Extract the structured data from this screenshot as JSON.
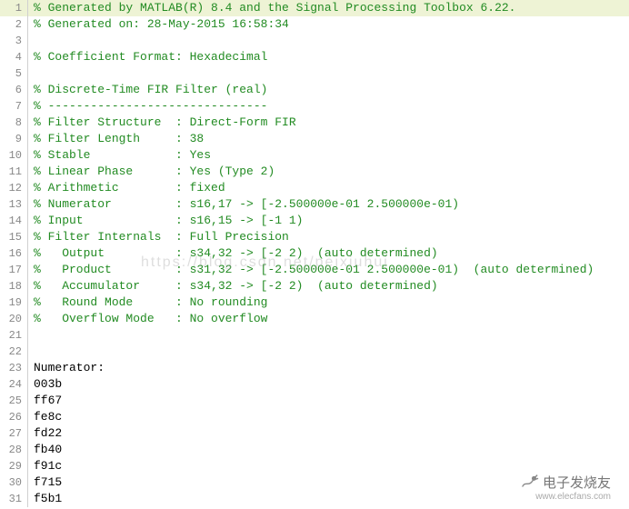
{
  "lines": [
    {
      "num": 1,
      "text": "% Generated by MATLAB(R) 8.4 and the Signal Processing Toolbox 6.22.",
      "comment": true,
      "hl": true
    },
    {
      "num": 2,
      "text": "% Generated on: 28-May-2015 16:58:34",
      "comment": true
    },
    {
      "num": 3,
      "text": "",
      "comment": true
    },
    {
      "num": 4,
      "text": "% Coefficient Format: Hexadecimal",
      "comment": true
    },
    {
      "num": 5,
      "text": "",
      "comment": true
    },
    {
      "num": 6,
      "text": "% Discrete-Time FIR Filter (real)",
      "comment": true
    },
    {
      "num": 7,
      "text": "% -------------------------------",
      "comment": true
    },
    {
      "num": 8,
      "text": "% Filter Structure  : Direct-Form FIR",
      "comment": true
    },
    {
      "num": 9,
      "text": "% Filter Length     : 38",
      "comment": true
    },
    {
      "num": 10,
      "text": "% Stable            : Yes",
      "comment": true
    },
    {
      "num": 11,
      "text": "% Linear Phase      : Yes (Type 2)",
      "comment": true
    },
    {
      "num": 12,
      "text": "% Arithmetic        : fixed",
      "comment": true
    },
    {
      "num": 13,
      "text": "% Numerator         : s16,17 -> [-2.500000e-01 2.500000e-01)",
      "comment": true
    },
    {
      "num": 14,
      "text": "% Input             : s16,15 -> [-1 1)",
      "comment": true
    },
    {
      "num": 15,
      "text": "% Filter Internals  : Full Precision",
      "comment": true
    },
    {
      "num": 16,
      "text": "%   Output          : s34,32 -> [-2 2)  (auto determined)",
      "comment": true
    },
    {
      "num": 17,
      "text": "%   Product         : s31,32 -> [-2.500000e-01 2.500000e-01)  (auto determined)",
      "comment": true
    },
    {
      "num": 18,
      "text": "%   Accumulator     : s34,32 -> [-2 2)  (auto determined)",
      "comment": true
    },
    {
      "num": 19,
      "text": "%   Round Mode      : No rounding",
      "comment": true
    },
    {
      "num": 20,
      "text": "%   Overflow Mode   : No overflow",
      "comment": true
    },
    {
      "num": 21,
      "text": "",
      "comment": true
    },
    {
      "num": 22,
      "text": "",
      "comment": true
    },
    {
      "num": 23,
      "text": "Numerator:",
      "comment": false
    },
    {
      "num": 24,
      "text": "003b",
      "comment": false
    },
    {
      "num": 25,
      "text": "ff67",
      "comment": false
    },
    {
      "num": 26,
      "text": "fe8c",
      "comment": false
    },
    {
      "num": 27,
      "text": "fd22",
      "comment": false
    },
    {
      "num": 28,
      "text": "fb40",
      "comment": false
    },
    {
      "num": 29,
      "text": "f91c",
      "comment": false
    },
    {
      "num": 30,
      "text": "f715",
      "comment": false
    },
    {
      "num": 31,
      "text": "f5b1",
      "comment": false
    }
  ],
  "watermark": "https://blog.csdn.net/peixiuhui",
  "footer": {
    "brand": "电子发烧友",
    "url": "www.elecfans.com"
  }
}
